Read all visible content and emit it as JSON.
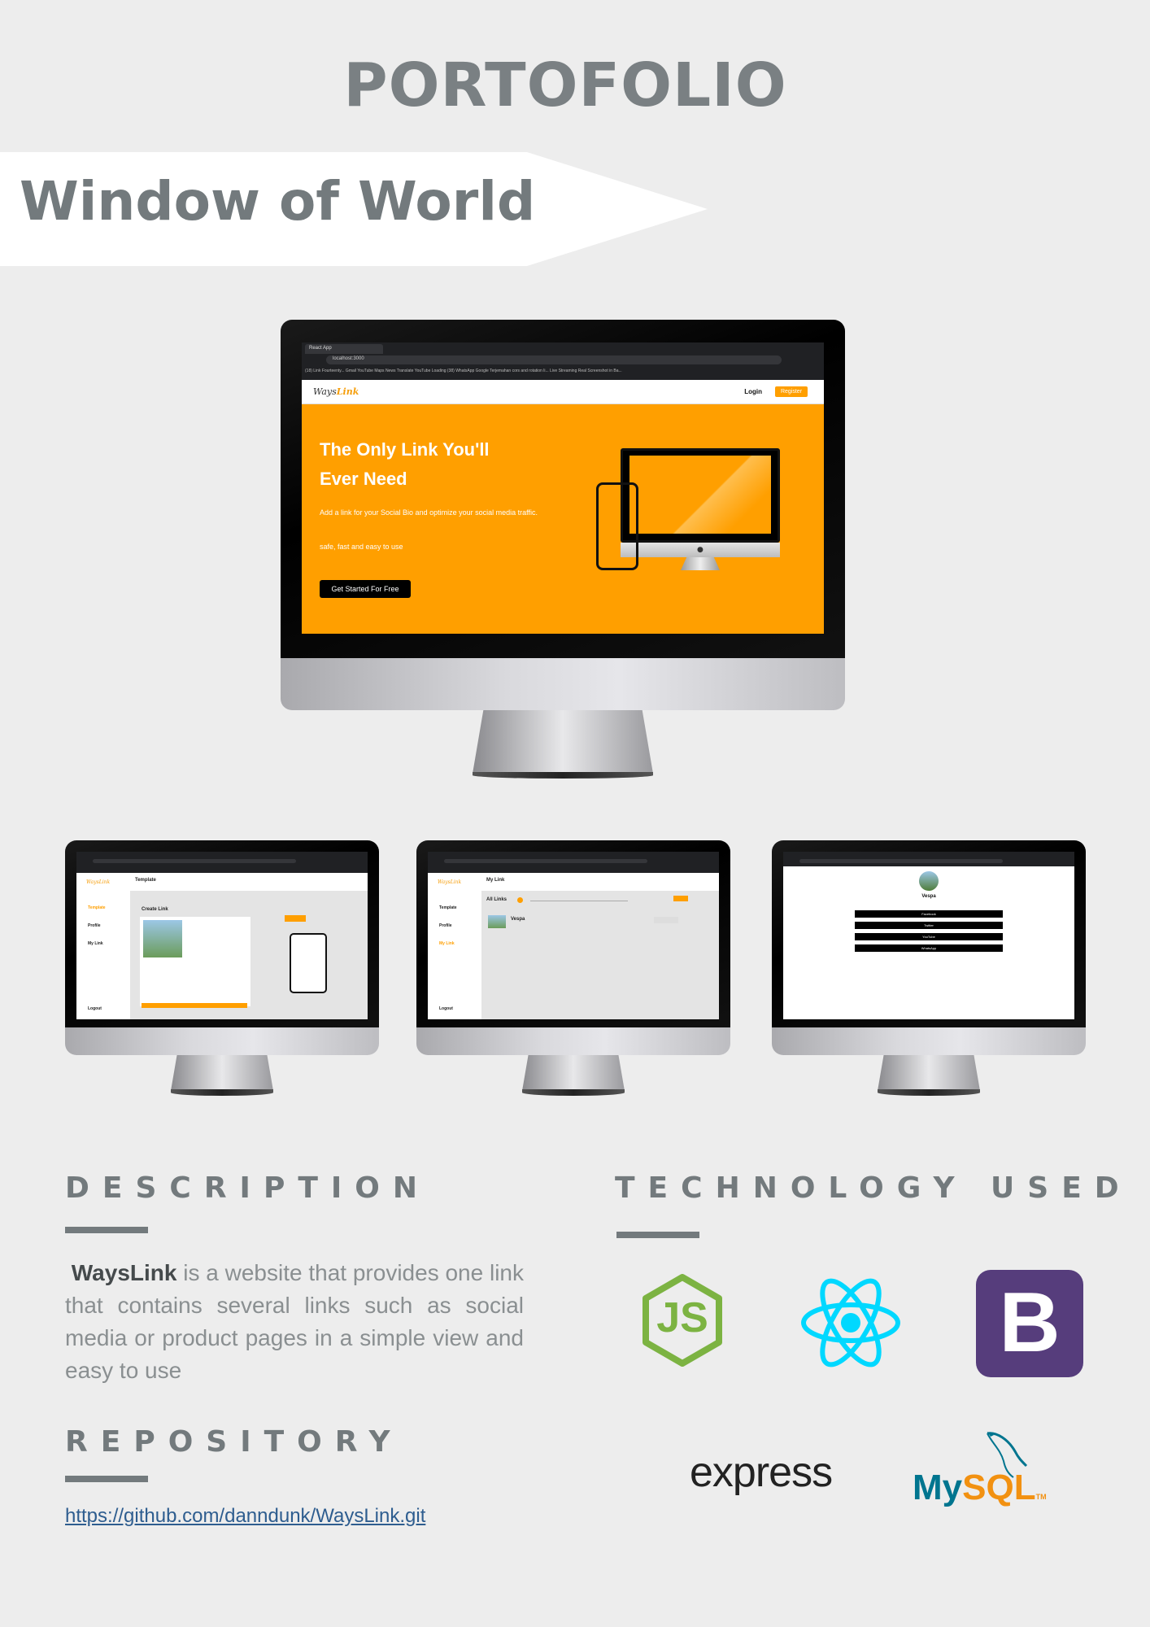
{
  "header": {
    "title": "PORTOFOLIO"
  },
  "banner": {
    "title": "Window of World"
  },
  "hero_screen": {
    "tab": "React App",
    "url": "localhost:3000",
    "bookmarks": "(18) Link Fourteenty...   Gmail   YouTube   Maps   News   Translate   YouTube   Loading   (38) WhatsApp   Google Terjemahan   cors and rotation li...   Live Streaming   Real Screenshot in Ba...",
    "logo_prefix": "Ways",
    "logo_suffix": "Link",
    "login": "Login",
    "register": "Register",
    "headline": "The Only Link You'll Ever Need",
    "subtext": "Add a link for your Social Bio and optimize your social media traffic.",
    "subtext2": "safe, fast and easy to use",
    "cta": "Get Started For Free"
  },
  "small_screen_1": {
    "menu": [
      "Template",
      "Profile",
      "My Link"
    ],
    "header": "Template",
    "title": "Create Link",
    "logout": "Logout"
  },
  "small_screen_2": {
    "menu": [
      "Template",
      "Profile",
      "My Link"
    ],
    "header": "My Link",
    "all_links": "All Links",
    "item": "Vespa",
    "logout": "Logout"
  },
  "small_screen_3": {
    "name": "Vespa",
    "links": [
      "Facebook",
      "Twitter",
      "YouTube",
      "WhatsApp"
    ]
  },
  "description": {
    "heading": "DESCRIPTION",
    "brand": "WaysLink",
    "text": " is a website that provides one link that contains several links such as social media or product pages in a simple view and easy to use"
  },
  "repository": {
    "heading": "REPOSITORY",
    "url": "https://github.com/danndunk/WaysLink.git"
  },
  "technology": {
    "heading": "TECHNOLOGY USED",
    "items": [
      "nodejs-logo",
      "react-logo",
      "bootstrap-logo",
      "express-logo",
      "mysql-logo"
    ],
    "node_label": "JS",
    "bootstrap_label": "B",
    "express_label": "express",
    "mysql_my": "My",
    "mysql_sql": "SQL",
    "mysql_tm": "TM"
  },
  "colors": {
    "accent": "#ff9f00",
    "heading": "#737a7d",
    "bootstrap": "#563d7c",
    "react": "#00d8ff",
    "node": "#7cb342"
  }
}
